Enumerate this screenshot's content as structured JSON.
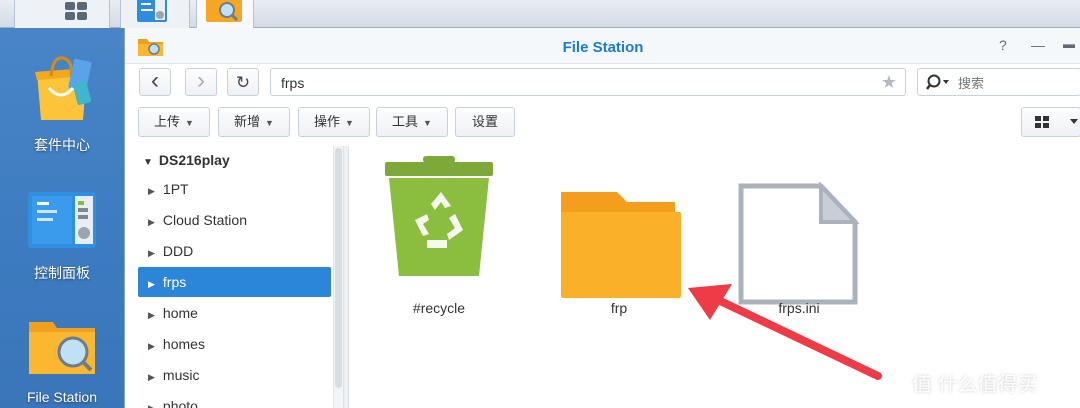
{
  "desktop": {
    "items": [
      {
        "label": "套件中心",
        "icon": "package-center-icon"
      },
      {
        "label": "控制面板",
        "icon": "control-panel-icon"
      },
      {
        "label": "File Station",
        "icon": "file-station-icon"
      }
    ]
  },
  "window": {
    "title": "File Station",
    "help_glyph": "?",
    "minimize_glyph": "—",
    "maximize_glyph": "▬",
    "nav": {
      "back": "‹",
      "forward": "›",
      "refresh": "↻"
    },
    "path": "frps",
    "search": {
      "placeholder": "搜索"
    },
    "toolbar": {
      "upload": "上传",
      "new": "新增",
      "action": "操作",
      "tools": "工具",
      "settings": "设置"
    },
    "tree": {
      "root": "DS216play",
      "items": [
        {
          "label": "1PT"
        },
        {
          "label": "Cloud Station"
        },
        {
          "label": "DDD"
        },
        {
          "label": "frps",
          "selected": true
        },
        {
          "label": "home"
        },
        {
          "label": "homes"
        },
        {
          "label": "music"
        },
        {
          "label": "photo"
        }
      ]
    },
    "files": [
      {
        "name": "#recycle",
        "icon": "recycle-bin-icon"
      },
      {
        "name": "frp",
        "icon": "folder-icon"
      },
      {
        "name": "frps.ini",
        "icon": "document-icon"
      }
    ]
  },
  "watermark": "值 什么值得买",
  "colors": {
    "accent": "#2b86da",
    "title": "#1a7ad6",
    "arrow": "#ee3b46",
    "recycle_green": "#8bbd3f",
    "folder_orange": "#fbb02a"
  }
}
